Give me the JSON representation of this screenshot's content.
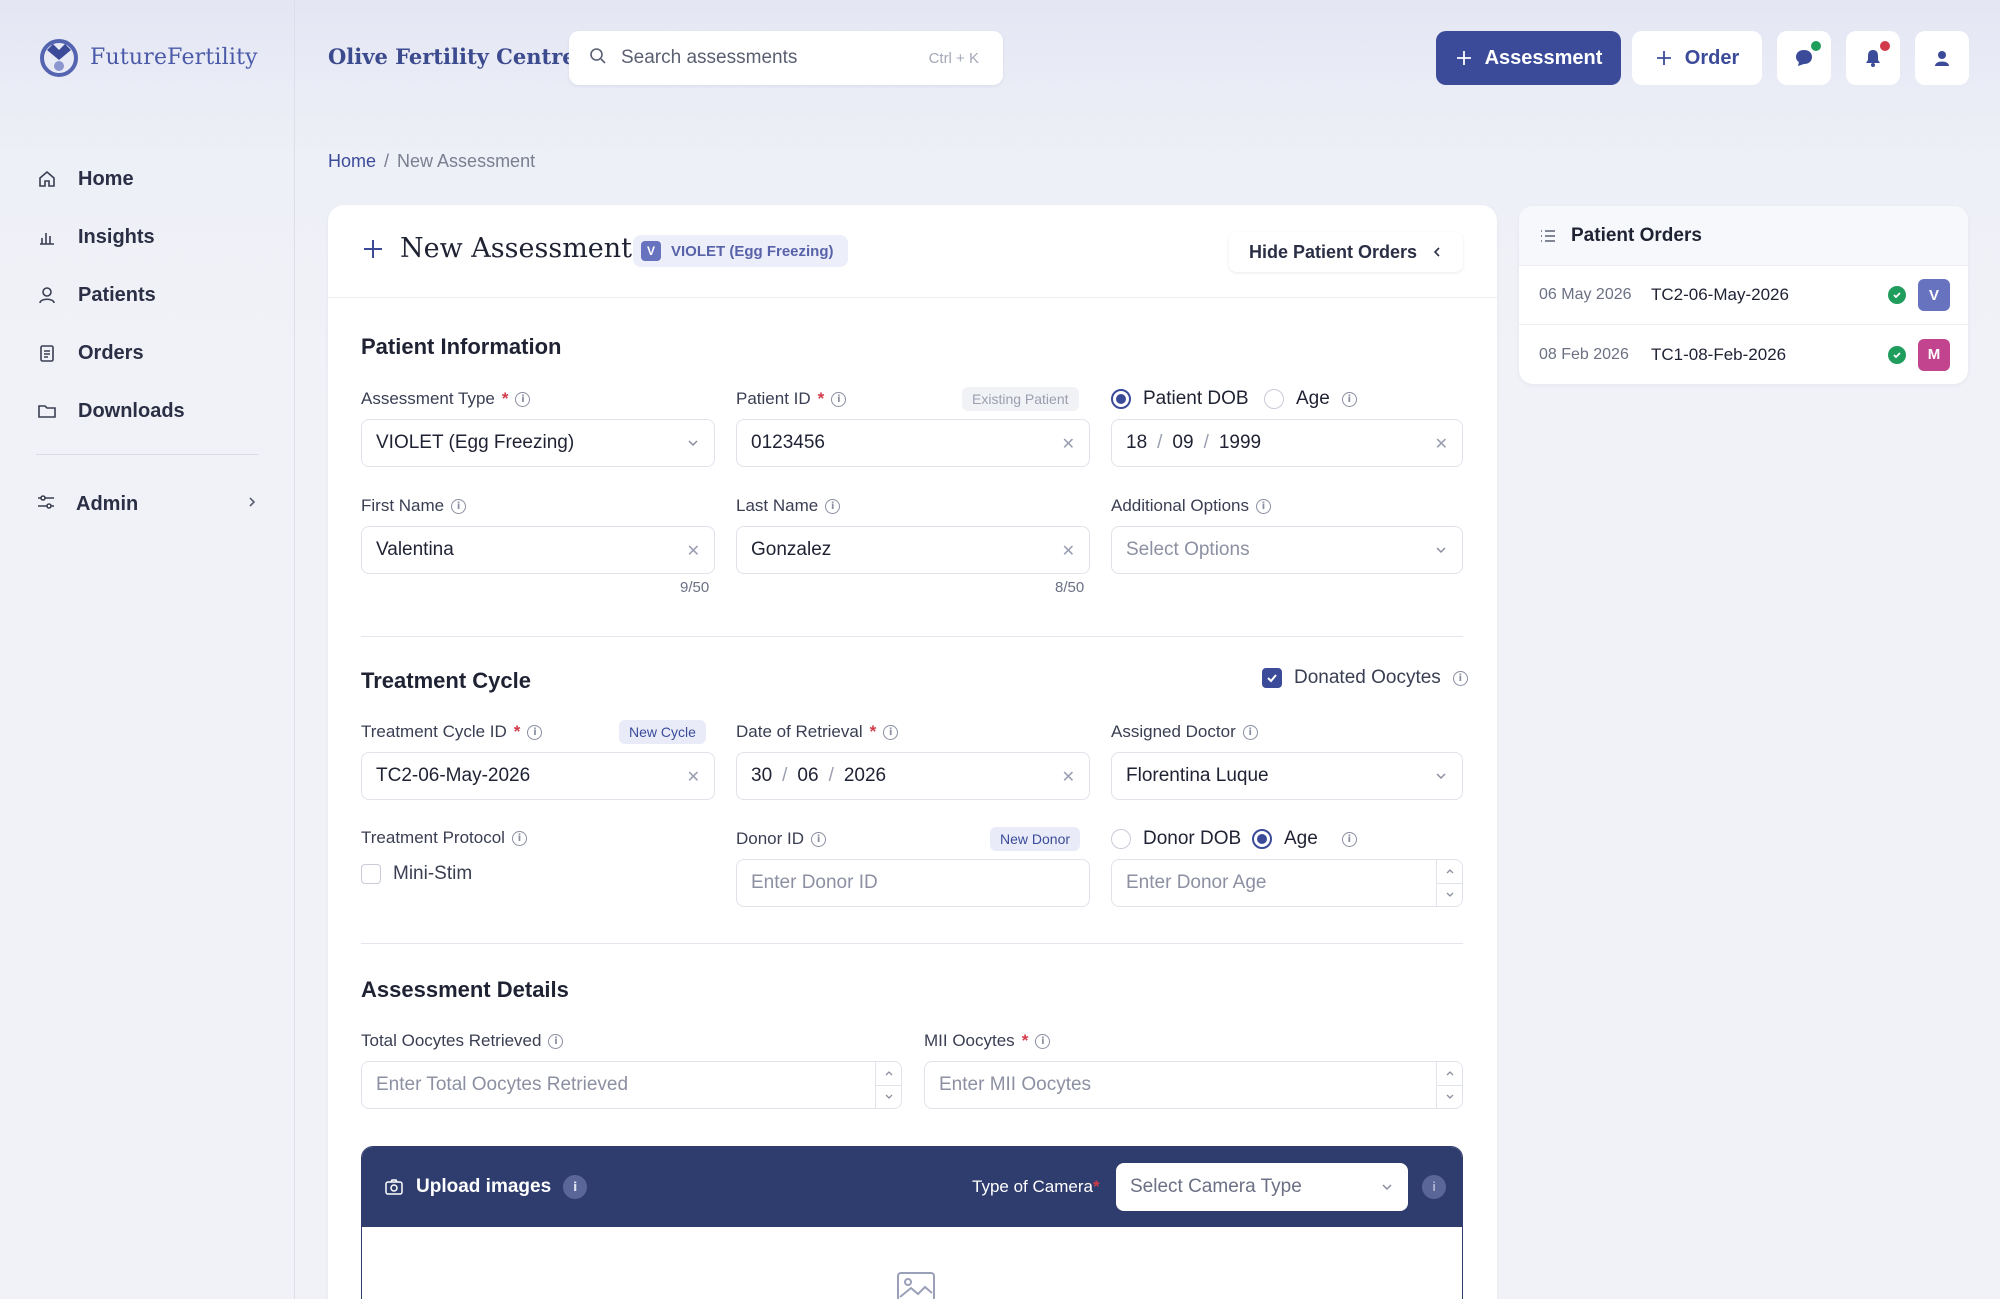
{
  "brand": {
    "name": "FutureFertility",
    "accent": "#3b4b99"
  },
  "sidebar": {
    "items": [
      {
        "label": "Home",
        "icon": "home-icon"
      },
      {
        "label": "Insights",
        "icon": "chart-icon"
      },
      {
        "label": "Patients",
        "icon": "user-icon"
      },
      {
        "label": "Orders",
        "icon": "clipboard-icon"
      },
      {
        "label": "Downloads",
        "icon": "folder-icon"
      }
    ],
    "admin": {
      "label": "Admin",
      "icon": "sliders-icon"
    }
  },
  "header": {
    "clinic": "Olive Fertility Centre",
    "search_placeholder": "Search assessments",
    "search_shortcut": "Ctrl + K",
    "assessment_button": "Assessment",
    "order_button": "Order"
  },
  "breadcrumb": {
    "home": "Home",
    "separator": "/",
    "current": "New Assessment"
  },
  "card": {
    "title": "New Assessment",
    "badge_letter": "V",
    "badge_text": "VIOLET (Egg Freezing)",
    "hide_orders": "Hide Patient Orders"
  },
  "patient_info": {
    "title": "Patient Information",
    "assessment_type": {
      "label": "Assessment Type",
      "value": "VIOLET (Egg Freezing)"
    },
    "patient_id": {
      "label": "Patient ID",
      "tag": "Existing Patient",
      "value": "0123456"
    },
    "dob": {
      "option_dob": "Patient DOB",
      "option_age": "Age",
      "day": "18",
      "month": "09",
      "year": "1999",
      "sep": "/"
    },
    "first_name": {
      "label": "First Name",
      "value": "Valentina",
      "counter": "9/50"
    },
    "last_name": {
      "label": "Last Name",
      "value": "Gonzalez",
      "counter": "8/50"
    },
    "additional": {
      "label": "Additional Options",
      "placeholder": "Select Options"
    }
  },
  "treatment": {
    "title": "Treatment Cycle",
    "donated": "Donated Oocytes",
    "cycle_id": {
      "label": "Treatment Cycle ID",
      "tag": "New Cycle",
      "value": "TC2-06-May-2026"
    },
    "retrieval": {
      "label": "Date of Retrieval",
      "day": "30",
      "month": "06",
      "year": "2026",
      "sep": "/"
    },
    "doctor": {
      "label": "Assigned Doctor",
      "value": "Florentina Luque"
    },
    "protocol": {
      "label": "Treatment Protocol",
      "option": "Mini-Stim"
    },
    "donor_id": {
      "label": "Donor ID",
      "tag": "New Donor",
      "placeholder": "Enter Donor ID"
    },
    "donor_age": {
      "option_dob": "Donor DOB",
      "option_age": "Age",
      "placeholder": "Enter Donor Age"
    }
  },
  "assessment": {
    "title": "Assessment Details",
    "total": {
      "label": "Total Oocytes Retrieved",
      "placeholder": "Enter Total Oocytes Retrieved"
    },
    "mii": {
      "label": "MII Oocytes",
      "placeholder": "Enter MII Oocytes"
    }
  },
  "upload": {
    "title": "Upload images",
    "camera_label": "Type of Camera",
    "camera_placeholder": "Select Camera Type"
  },
  "orders": {
    "title": "Patient Orders",
    "rows": [
      {
        "date": "06 May 2026",
        "id": "TC2-06-May-2026",
        "avatar": "V",
        "color": "#6873c0"
      },
      {
        "date": "08 Feb 2026",
        "id": "TC1-08-Feb-2026",
        "avatar": "M",
        "color": "#c2448f"
      }
    ]
  }
}
